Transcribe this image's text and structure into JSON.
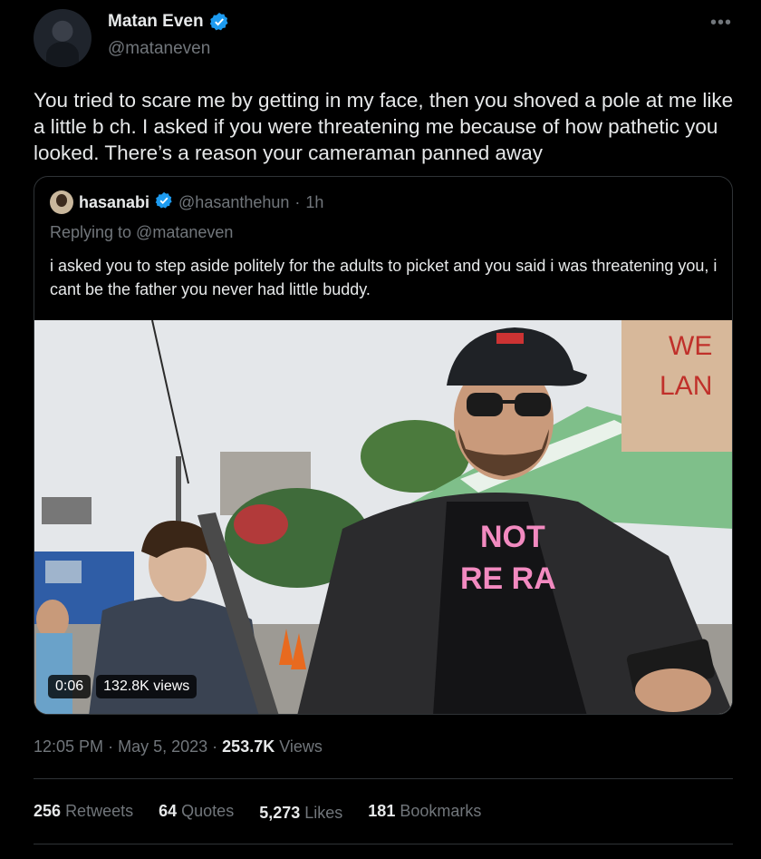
{
  "author": {
    "display_name": "Matan Even",
    "handle": "@mataneven",
    "verified": true,
    "avatar_icon": "profile-photo"
  },
  "more_icon": "ellipsis-icon",
  "tweet": {
    "text": "You tried to scare me by getting in my face, then you shoved a pole at me like a little b   ch. I asked if you were threatening me because of how pathetic you looked. There’s a reason your cameraman panned away"
  },
  "quoted_tweet": {
    "display_name": "hasanabi",
    "handle": "@hasanthehun",
    "time_separator": "·",
    "age": "1h",
    "replying_to": "Replying to @mataneven",
    "text": "i asked you to step aside politely for the adults to picket and you said i was threatening you, i cant be the father you never had little buddy.",
    "media": {
      "type": "video",
      "duration": "0:06",
      "views": "132.8K views",
      "sign_text": [
        "WE",
        "LAN"
      ],
      "shirt_text": [
        "NOT",
        "RE RA"
      ]
    }
  },
  "meta": {
    "time": "12:05 PM",
    "date": "May 5, 2023",
    "views_count": "253.7K",
    "views_label": "Views",
    "separator": "·"
  },
  "stats": {
    "retweets_count": "256",
    "retweets_label": "Retweets",
    "quotes_count": "64",
    "quotes_label": "Quotes",
    "likes_count": "5,273",
    "likes_label": "Likes",
    "bookmarks_count": "181",
    "bookmarks_label": "Bookmarks"
  },
  "colors": {
    "background": "#000000",
    "text": "#e7e9ea",
    "muted": "#71767b",
    "border": "#2f3336",
    "verified": "#1d9bf0"
  }
}
